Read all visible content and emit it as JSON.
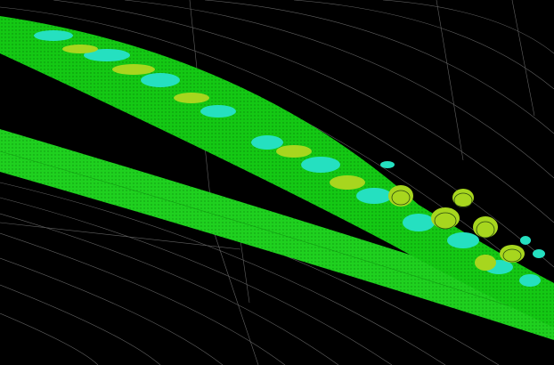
{
  "view": {
    "background": "#000000",
    "mesh_line_color": "#8a8a8a",
    "lower_band_color": "#19d219",
    "upper_band_color": "#22cc22",
    "vortex_color_high": "#25e0c0",
    "vortex_color_mid": "#a7d61e",
    "vortex_color_edge": "#6ea410"
  }
}
